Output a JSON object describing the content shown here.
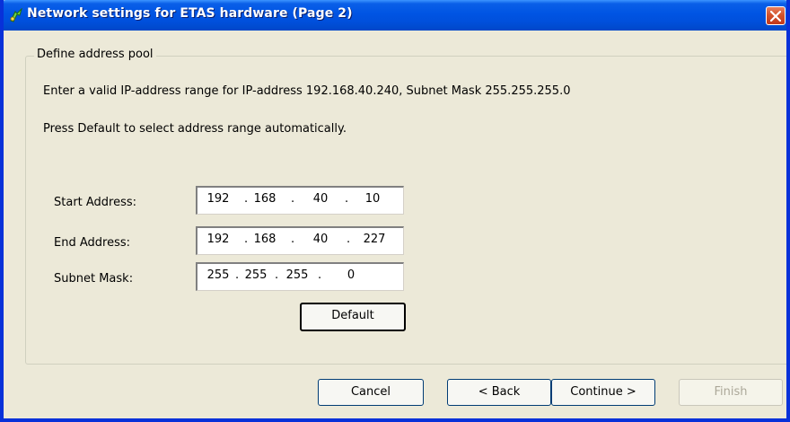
{
  "window": {
    "title": "Network settings for ETAS hardware (Page 2)"
  },
  "group": {
    "legend": "Define address pool",
    "description": "Enter a valid IP-address range for IP-address 192.168.40.240, Subnet Mask 255.255.255.0",
    "hint": "Press Default to select address range automatically."
  },
  "fields": {
    "start": {
      "label": "Start Address:",
      "octets": [
        "192",
        "168",
        "40",
        "10"
      ]
    },
    "end": {
      "label": "End Address:",
      "octets": [
        "192",
        "168",
        "40",
        "227"
      ]
    },
    "mask": {
      "label": "Subnet Mask:",
      "octets": [
        "255",
        "255",
        "255",
        "0"
      ]
    },
    "separator": "."
  },
  "buttons": {
    "default": "Default",
    "cancel": "Cancel",
    "back": "< Back",
    "continue": "Continue >",
    "finish": "Finish"
  },
  "icons": {
    "title": "etas-hardware-icon",
    "close": "close-icon"
  },
  "colors": {
    "titlebar": "#0054e3",
    "dialog_background": "#ece9d8",
    "close_button": "#d4532c",
    "disabled_text": "#aca899"
  }
}
